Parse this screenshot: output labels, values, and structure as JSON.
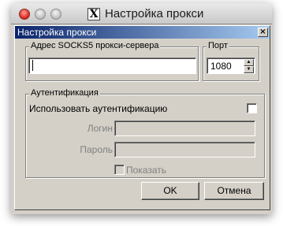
{
  "mac_window": {
    "title": "Настройка прокси",
    "app_icon_glyph": "X",
    "app_icon": "x11-icon"
  },
  "dialog": {
    "title": "Настройка прокси",
    "close_glyph": "×"
  },
  "proxy_address": {
    "group_label": "Адрес SOCKS5 прокси-сервера",
    "value": ""
  },
  "port": {
    "group_label": "Порт",
    "value": "1080",
    "spin_up_glyph": "▲",
    "spin_down_glyph": "▼"
  },
  "auth": {
    "group_label": "Аутентификация",
    "use_auth_label": "Использовать аутентификацию",
    "use_auth_checked": false,
    "login_label": "Логин",
    "login_value": "",
    "password_label": "Пароль",
    "password_value": "",
    "show_label": "Показать",
    "show_checked": false
  },
  "buttons": {
    "ok_label": "OK",
    "cancel_label": "Отмена"
  }
}
